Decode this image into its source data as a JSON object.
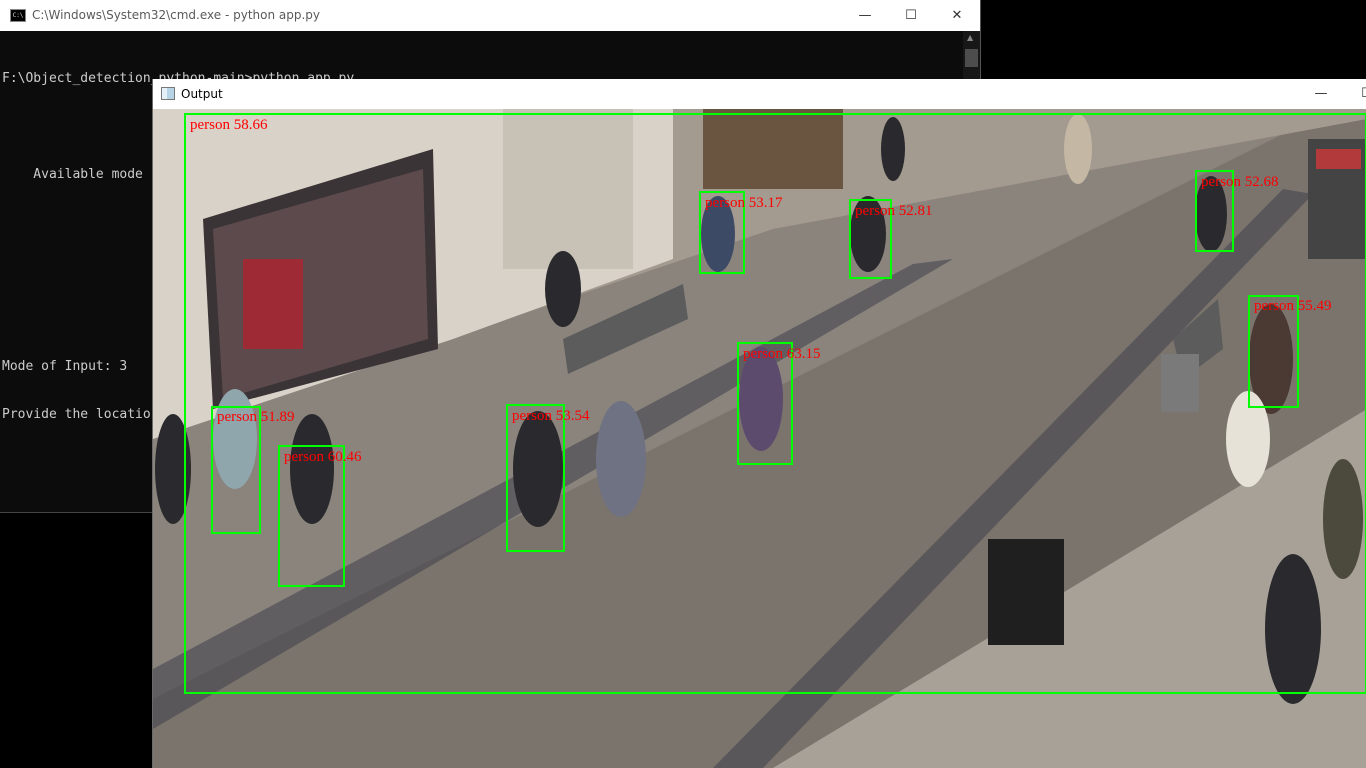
{
  "cmd": {
    "title": "C:\\Windows\\System32\\cmd.exe - python  app.py",
    "icon": "cmd-app-icon",
    "icon_text": "C:\\",
    "controls": {
      "minimize": "—",
      "maximize": "☐",
      "close": "✕"
    },
    "lines": [
      "F:\\Object_detection_python-main>python app.py",
      "",
      "    Available mode",
      "",
      "",
      "",
      "Mode of Input: 3",
      "Provide the locatio"
    ]
  },
  "output": {
    "title": "Output",
    "icon": "image-window-icon",
    "controls": {
      "minimize": "—",
      "maximize": "☐"
    },
    "colors": {
      "box": "#00ff00",
      "label": "#ff0000"
    },
    "detections": [
      {
        "label": "person  58.66"
      },
      {
        "label": "person  53.17"
      },
      {
        "label": "person  52.81"
      },
      {
        "label": "person  52.68"
      },
      {
        "label": "person  55.49"
      },
      {
        "label": "person  63.15"
      },
      {
        "label": "person  51.89"
      },
      {
        "label": "person  60.46"
      },
      {
        "label": "person  53.54"
      }
    ]
  }
}
